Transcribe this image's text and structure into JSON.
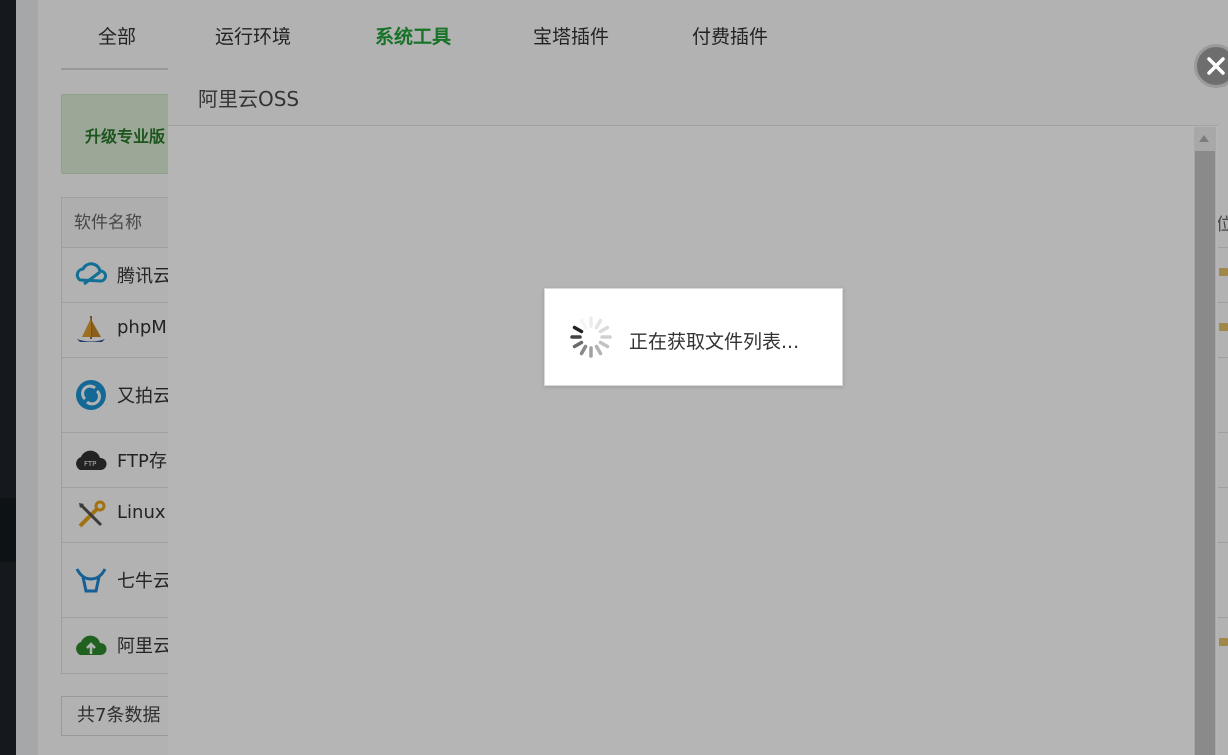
{
  "tabs": [
    {
      "label": "全部"
    },
    {
      "label": "运行环境"
    },
    {
      "label": "系统工具"
    },
    {
      "label": "宝塔插件"
    },
    {
      "label": "付费插件"
    }
  ],
  "active_tab": "系统工具",
  "promo": {
    "text": "升级专业版"
  },
  "table": {
    "header": "软件名称",
    "rows": [
      {
        "name": "腾讯云",
        "icon": "tencent-cloud-icon"
      },
      {
        "name": "phpM",
        "icon": "phpmyadmin-sailboat-icon"
      },
      {
        "name": "又拍云",
        "icon": "upyun-icon"
      },
      {
        "name": "FTP存",
        "icon": "ftp-cloud-icon"
      },
      {
        "name": "Linux",
        "icon": "tools-icon"
      },
      {
        "name": "七牛云",
        "icon": "qiniu-icon"
      },
      {
        "name": "阿里云",
        "icon": "aliyun-icon"
      }
    ]
  },
  "footer": {
    "text": "共7条数据"
  },
  "right_col_fragment": "位",
  "modal": {
    "title": "阿里云OSS"
  },
  "loading": {
    "text": "正在获取文件列表..."
  },
  "colors": {
    "accent": "#20a53a",
    "shade": "rgba(0,0,0,0.30)"
  }
}
